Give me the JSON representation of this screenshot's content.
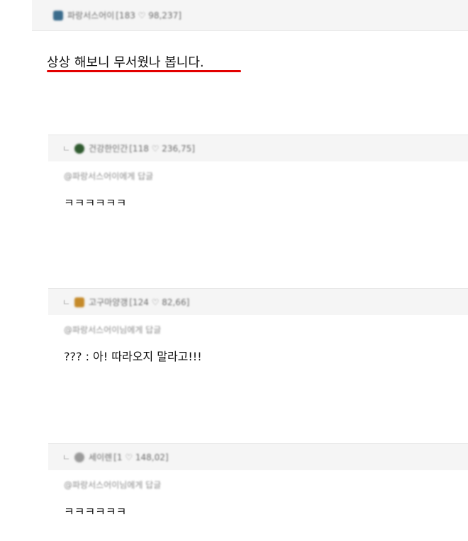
{
  "post": {
    "author": "파랑서스어이",
    "stats": "[183 ♡ 98,237]",
    "body": "상상 해보니 무서웠나 봅니다."
  },
  "comments": [
    {
      "reply_icon": "ㄴ",
      "author": "건강한인간",
      "stats": "[118 ♡ 236,75]",
      "mention": "@파랑서스어이에게 답글",
      "text": "ㅋㅋㅋㅋㅋㅋ"
    },
    {
      "reply_icon": "ㄴ",
      "author": "고구마양갱",
      "stats": "[124 ♡ 82,66]",
      "mention": "@파랑서스어이님에게 답글",
      "text": "??? : 아! 따라오지 말라고!!!"
    },
    {
      "reply_icon": "ㄴ",
      "author": "세이렌",
      "stats": "[1 ♡ 148,02]",
      "mention": "@파랑서스어이님에게 답글",
      "text": "ㅋㅋㅋㅋㅋㅋ"
    }
  ],
  "colors": {
    "underline": "#e30000",
    "header_bg": "#f5f5f5",
    "avatar_post": "#3a6b8c",
    "avatar_c1": "#2f5a2f",
    "avatar_c2": "#c58a2a",
    "avatar_c3": "#9a9a9a"
  }
}
